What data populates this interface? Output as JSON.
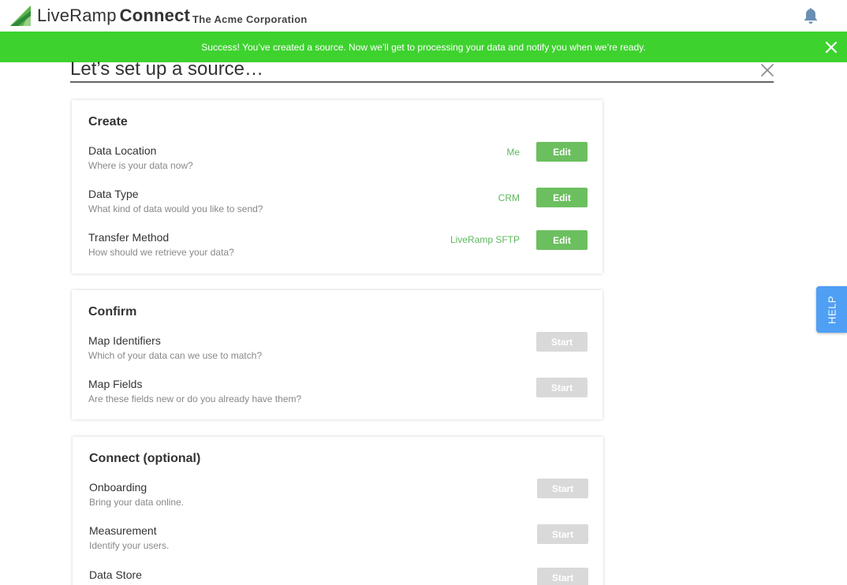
{
  "header": {
    "logo_light": "LiveRamp",
    "logo_bold": "Connect",
    "company": "The Acme Corporation",
    "icons": {
      "logo": "liveramp-logo-icon",
      "bell": "bell-icon"
    }
  },
  "banner": {
    "message": "Success! You’ve created a source. Now we’ll get to processing your data and notify you when we’re ready.",
    "color": "#3ed22f",
    "close_icon": "close-icon"
  },
  "page": {
    "title": "Let’s set up a source…",
    "close_icon": "close-icon"
  },
  "sections": {
    "create": {
      "title": "Create",
      "rows": [
        {
          "label": "Data Location",
          "desc": "Where is your data now?",
          "value": "Me",
          "button": "Edit"
        },
        {
          "label": "Data Type",
          "desc": "What kind of data would you like to send?",
          "value": "CRM",
          "button": "Edit"
        },
        {
          "label": "Transfer Method",
          "desc": "How should we retrieve your data?",
          "value": "LiveRamp SFTP",
          "button": "Edit"
        }
      ]
    },
    "confirm": {
      "title": "Confirm",
      "rows": [
        {
          "label": "Map Identifiers",
          "desc": "Which of your data can we use to match?",
          "button": "Start"
        },
        {
          "label": "Map Fields",
          "desc": "Are these fields new or do you already have them?",
          "button": "Start"
        }
      ]
    },
    "connect": {
      "title": "Connect (optional)",
      "rows": [
        {
          "label": "Onboarding",
          "desc": "Bring your data online.",
          "button": "Start"
        },
        {
          "label": "Measurement",
          "desc": "Identify your users.",
          "button": "Start"
        },
        {
          "label": "Data Store",
          "desc": "",
          "button": "Start"
        }
      ]
    }
  },
  "help": {
    "label": "HELP",
    "color": "#4f9ff5"
  },
  "colors": {
    "edit_button": "#6cbf5f",
    "start_button": "#d9d9d9",
    "value_text": "#5cb85c"
  }
}
